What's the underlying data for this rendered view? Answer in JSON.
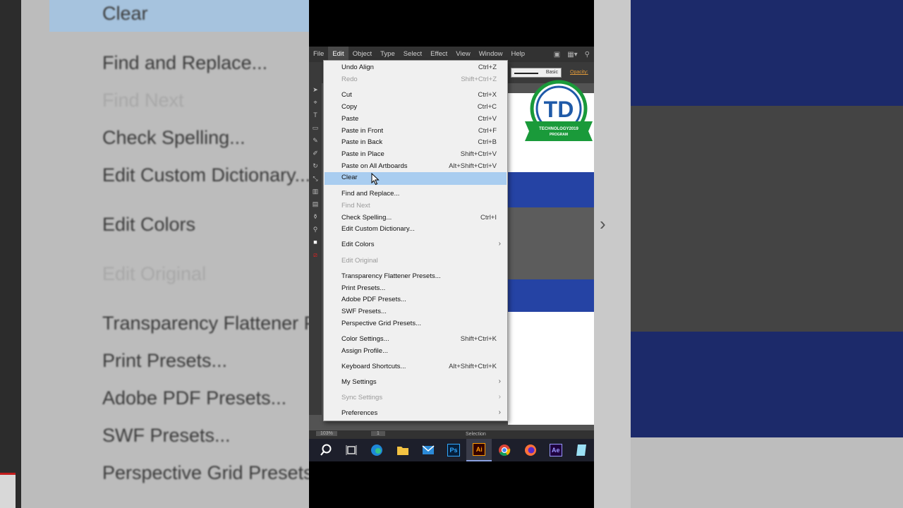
{
  "background_left": {
    "items": [
      {
        "label": "Clear",
        "disabled": false
      },
      {
        "label": "Find and Replace...",
        "disabled": false
      },
      {
        "label": "Find Next",
        "disabled": true
      },
      {
        "label": "Check Spelling...",
        "disabled": false
      },
      {
        "label": "Edit Custom Dictionary...",
        "disabled": false
      },
      {
        "label": "Edit Colors",
        "disabled": false
      },
      {
        "label": "Edit Original",
        "disabled": true
      },
      {
        "label": "Transparency Flattener Presets...",
        "disabled": false
      },
      {
        "label": "Print Presets...",
        "disabled": false
      },
      {
        "label": "Adobe PDF Presets...",
        "disabled": false
      },
      {
        "label": "SWF Presets...",
        "disabled": false
      },
      {
        "label": "Perspective Grid Presets...",
        "disabled": false
      }
    ]
  },
  "menubar": {
    "items": [
      "File",
      "Edit",
      "Object",
      "Type",
      "Select",
      "Effect",
      "View",
      "Window",
      "Help"
    ],
    "active": "Edit"
  },
  "controlbar": {
    "stroke_style": "Basic",
    "opacity_label": "Opacity:"
  },
  "logo": {
    "initials": "TD",
    "text_line1": "TECHNOLOGY2019",
    "text_line2": "PROGRAM",
    "colors": {
      "ring": "#1a9a3a",
      "letters": "#1f5aa8",
      "banner": "#1a9a3a"
    }
  },
  "statusbar": {
    "zoom": "103%",
    "artboard": "1",
    "mode": "Selection"
  },
  "edit_menu": {
    "items": [
      {
        "label": "Undo Align",
        "shortcut": "Ctrl+Z",
        "disabled": false,
        "submenu": false
      },
      {
        "label": "Redo",
        "shortcut": "Shift+Ctrl+Z",
        "disabled": true,
        "submenu": false
      },
      {
        "label": "Cut",
        "shortcut": "Ctrl+X",
        "disabled": false,
        "submenu": false
      },
      {
        "label": "Copy",
        "shortcut": "Ctrl+C",
        "disabled": false,
        "submenu": false
      },
      {
        "label": "Paste",
        "shortcut": "Ctrl+V",
        "disabled": false,
        "submenu": false
      },
      {
        "label": "Paste in Front",
        "shortcut": "Ctrl+F",
        "disabled": false,
        "submenu": false
      },
      {
        "label": "Paste in Back",
        "shortcut": "Ctrl+B",
        "disabled": false,
        "submenu": false
      },
      {
        "label": "Paste in Place",
        "shortcut": "Shift+Ctrl+V",
        "disabled": false,
        "submenu": false
      },
      {
        "label": "Paste on All Artboards",
        "shortcut": "Alt+Shift+Ctrl+V",
        "disabled": false,
        "submenu": false
      },
      {
        "label": "Clear",
        "shortcut": "",
        "disabled": false,
        "submenu": false,
        "highlighted": true
      },
      {
        "label": "Find and Replace...",
        "shortcut": "",
        "disabled": false,
        "submenu": false
      },
      {
        "label": "Find Next",
        "shortcut": "",
        "disabled": true,
        "submenu": false
      },
      {
        "label": "Check Spelling...",
        "shortcut": "Ctrl+I",
        "disabled": false,
        "submenu": false
      },
      {
        "label": "Edit Custom Dictionary...",
        "shortcut": "",
        "disabled": false,
        "submenu": false
      },
      {
        "label": "Edit Colors",
        "shortcut": "",
        "disabled": false,
        "submenu": true
      },
      {
        "label": "Edit Original",
        "shortcut": "",
        "disabled": true,
        "submenu": false
      },
      {
        "label": "Transparency Flattener Presets...",
        "shortcut": "",
        "disabled": false,
        "submenu": false
      },
      {
        "label": "Print Presets...",
        "shortcut": "",
        "disabled": false,
        "submenu": false
      },
      {
        "label": "Adobe PDF Presets...",
        "shortcut": "",
        "disabled": false,
        "submenu": false
      },
      {
        "label": "SWF Presets...",
        "shortcut": "",
        "disabled": false,
        "submenu": false
      },
      {
        "label": "Perspective Grid Presets...",
        "shortcut": "",
        "disabled": false,
        "submenu": false
      },
      {
        "label": "Color Settings...",
        "shortcut": "Shift+Ctrl+K",
        "disabled": false,
        "submenu": false
      },
      {
        "label": "Assign Profile...",
        "shortcut": "",
        "disabled": false,
        "submenu": false
      },
      {
        "label": "Keyboard Shortcuts...",
        "shortcut": "Alt+Shift+Ctrl+K",
        "disabled": false,
        "submenu": false
      },
      {
        "label": "My Settings",
        "shortcut": "",
        "disabled": false,
        "submenu": true
      },
      {
        "label": "Sync Settings",
        "shortcut": "",
        "disabled": true,
        "submenu": true
      },
      {
        "label": "Preferences",
        "shortcut": "",
        "disabled": false,
        "submenu": true
      }
    ]
  },
  "taskbar": {
    "icons": [
      "search-icon",
      "task-view-icon",
      "edge-icon",
      "file-explorer-icon",
      "mail-icon",
      "photoshop-icon",
      "illustrator-icon",
      "chrome-icon",
      "firefox-icon",
      "after-effects-icon",
      "notepad-icon"
    ],
    "photoshop_label": "Ps",
    "illustrator_label": "Ai",
    "after_effects_label": "Ae",
    "active": "illustrator-icon"
  }
}
